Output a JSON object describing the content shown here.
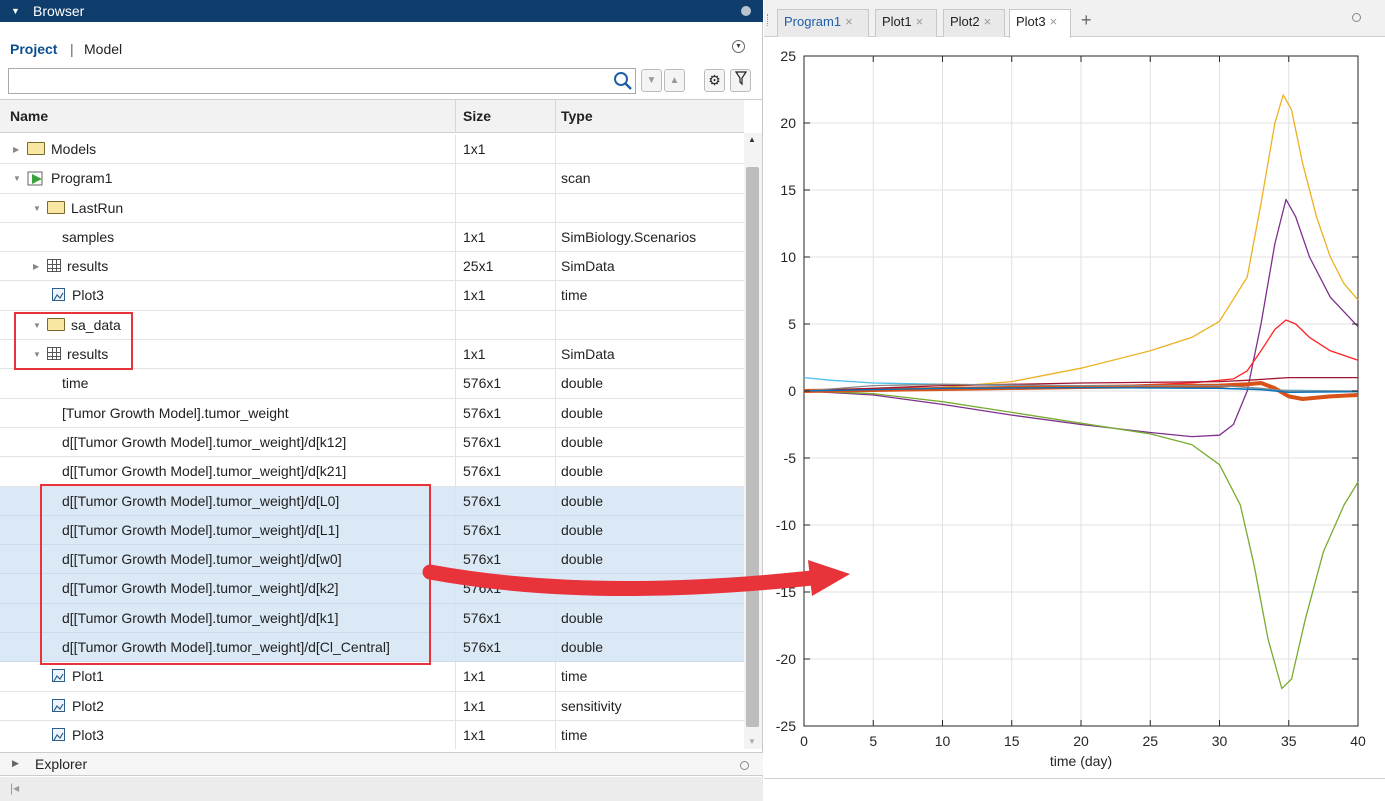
{
  "browser": {
    "title": "Browser"
  },
  "project_tabs": {
    "project": "Project",
    "separator": "|",
    "model": "Model"
  },
  "search": {
    "value": "",
    "placeholder": ""
  },
  "table": {
    "headers": {
      "name": "Name",
      "size": "Size",
      "type": "Type"
    },
    "rows": [
      {
        "name": "Models",
        "size": "1x1",
        "type": "",
        "icon": "folder-icon",
        "twisty": "collapsed"
      },
      {
        "name": "Program1",
        "size": "",
        "type": "scan",
        "icon": "program-icon",
        "twisty": "expanded"
      },
      {
        "name": "LastRun",
        "size": "",
        "type": "",
        "icon": "folder-icon",
        "twisty": "expanded"
      },
      {
        "name": "samples",
        "size": "1x1",
        "type": "SimBiology.Scenarios",
        "icon": "",
        "twisty": ""
      },
      {
        "name": "results",
        "size": "25x1",
        "type": "SimData",
        "icon": "table-icon",
        "twisty": "collapsed"
      },
      {
        "name": "Plot3",
        "size": "1x1",
        "type": "time",
        "icon": "plot-icon",
        "twisty": ""
      },
      {
        "name": "sa_data",
        "size": "",
        "type": "",
        "icon": "folder-icon",
        "twisty": "expanded"
      },
      {
        "name": "results",
        "size": "1x1",
        "type": "SimData",
        "icon": "table-icon",
        "twisty": "expanded"
      },
      {
        "name": "time",
        "size": "576x1",
        "type": "double",
        "icon": "",
        "twisty": ""
      },
      {
        "name": "[Tumor Growth Model].tumor_weight",
        "size": "576x1",
        "type": "double",
        "icon": "",
        "twisty": ""
      },
      {
        "name": "d[[Tumor Growth Model].tumor_weight]/d[k12]",
        "size": "576x1",
        "type": "double",
        "icon": "",
        "twisty": ""
      },
      {
        "name": "d[[Tumor Growth Model].tumor_weight]/d[k21]",
        "size": "576x1",
        "type": "double",
        "icon": "",
        "twisty": ""
      },
      {
        "name": "d[[Tumor Growth Model].tumor_weight]/d[L0]",
        "size": "576x1",
        "type": "double",
        "icon": "",
        "twisty": "",
        "selected": true
      },
      {
        "name": "d[[Tumor Growth Model].tumor_weight]/d[L1]",
        "size": "576x1",
        "type": "double",
        "icon": "",
        "twisty": "",
        "selected": true
      },
      {
        "name": "d[[Tumor Growth Model].tumor_weight]/d[w0]",
        "size": "576x1",
        "type": "double",
        "icon": "",
        "twisty": "",
        "selected": true
      },
      {
        "name": "d[[Tumor Growth Model].tumor_weight]/d[k2]",
        "size": "576x1",
        "type": "double",
        "icon": "",
        "twisty": "",
        "selected": true
      },
      {
        "name": "d[[Tumor Growth Model].tumor_weight]/d[k1]",
        "size": "576x1",
        "type": "double",
        "icon": "",
        "twisty": "",
        "selected": true
      },
      {
        "name": "d[[Tumor Growth Model].tumor_weight]/d[Cl_Central]",
        "size": "576x1",
        "type": "double",
        "icon": "",
        "twisty": "",
        "selected": true
      },
      {
        "name": "Plot1",
        "size": "1x1",
        "type": "time",
        "icon": "plot-icon",
        "twisty": ""
      },
      {
        "name": "Plot2",
        "size": "1x1",
        "type": "sensitivity",
        "icon": "plot-icon",
        "twisty": ""
      },
      {
        "name": "Plot3",
        "size": "1x1",
        "type": "time",
        "icon": "plot-icon",
        "twisty": ""
      }
    ]
  },
  "explorer": {
    "title": "Explorer"
  },
  "tabs": [
    {
      "label": "Program1",
      "close": "×"
    },
    {
      "label": "Plot1",
      "close": "×"
    },
    {
      "label": "Plot2",
      "close": "×"
    },
    {
      "label": "Plot3",
      "close": "×",
      "active": true
    }
  ],
  "tab_add": "+",
  "colors": {
    "header_bg": "#0f3e6c",
    "selection": "#dbe9f6",
    "highlight_red": "#e8333a",
    "series": [
      "#edb120",
      "#7e2f8e",
      "#ff2222",
      "#77ac30",
      "#4dbeee",
      "#d95319",
      "#a2142f",
      "#0072bd",
      "#888888"
    ]
  },
  "chart_data": {
    "type": "line",
    "xlabel": "time (day)",
    "ylabel": "",
    "xlim": [
      0,
      40
    ],
    "ylim": [
      -25,
      25
    ],
    "xticks": [
      0,
      5,
      10,
      15,
      20,
      25,
      30,
      35,
      40
    ],
    "yticks": [
      -25,
      -20,
      -15,
      -10,
      -5,
      0,
      5,
      10,
      15,
      20,
      25
    ],
    "grid": true,
    "series": [
      {
        "color": "#edb120",
        "points": [
          [
            0,
            0
          ],
          [
            8,
            0.1
          ],
          [
            15,
            0.7
          ],
          [
            20,
            1.7
          ],
          [
            25,
            3
          ],
          [
            28,
            4
          ],
          [
            30,
            5.2
          ],
          [
            32,
            8.5
          ],
          [
            33,
            14
          ],
          [
            34,
            20
          ],
          [
            34.6,
            22.1
          ],
          [
            35.2,
            21
          ],
          [
            36,
            17
          ],
          [
            37,
            13
          ],
          [
            38,
            10
          ],
          [
            39,
            8
          ],
          [
            40,
            6.8
          ]
        ]
      },
      {
        "color": "#7e2f8e",
        "points": [
          [
            0,
            0
          ],
          [
            5,
            -0.3
          ],
          [
            10,
            -1
          ],
          [
            15,
            -1.8
          ],
          [
            20,
            -2.5
          ],
          [
            25,
            -3.1
          ],
          [
            28,
            -3.4
          ],
          [
            30,
            -3.3
          ],
          [
            31,
            -2.5
          ],
          [
            32,
            0
          ],
          [
            33,
            5
          ],
          [
            34,
            11
          ],
          [
            34.8,
            14.3
          ],
          [
            35.5,
            13
          ],
          [
            36.5,
            10
          ],
          [
            38,
            7
          ],
          [
            40,
            4.8
          ]
        ]
      },
      {
        "color": "#ff2222",
        "points": [
          [
            0,
            0
          ],
          [
            10,
            0.1
          ],
          [
            20,
            0.3
          ],
          [
            28,
            0.6
          ],
          [
            31,
            0.9
          ],
          [
            32,
            1.5
          ],
          [
            33,
            3
          ],
          [
            34,
            4.6
          ],
          [
            34.8,
            5.3
          ],
          [
            35.5,
            5
          ],
          [
            36.5,
            4
          ],
          [
            38,
            3
          ],
          [
            40,
            2.3
          ]
        ]
      },
      {
        "color": "#77ac30",
        "points": [
          [
            0,
            0
          ],
          [
            5,
            -0.2
          ],
          [
            10,
            -0.8
          ],
          [
            15,
            -1.6
          ],
          [
            20,
            -2.4
          ],
          [
            25,
            -3.2
          ],
          [
            28,
            -4
          ],
          [
            30,
            -5.5
          ],
          [
            31.5,
            -8.5
          ],
          [
            32.5,
            -13
          ],
          [
            33.5,
            -18.5
          ],
          [
            34.5,
            -22.2
          ],
          [
            35.2,
            -21.5
          ],
          [
            36.2,
            -17
          ],
          [
            37.5,
            -12
          ],
          [
            39,
            -8.5
          ],
          [
            40,
            -6.8
          ]
        ]
      },
      {
        "color": "#4dbeee",
        "points": [
          [
            0,
            1
          ],
          [
            2,
            0.8
          ],
          [
            5,
            0.6
          ],
          [
            10,
            0.5
          ],
          [
            20,
            0.3
          ],
          [
            30,
            0.2
          ],
          [
            35,
            0.05
          ],
          [
            40,
            0
          ]
        ]
      },
      {
        "color": "#d95319",
        "points": [
          [
            0,
            0
          ],
          [
            10,
            0.15
          ],
          [
            20,
            0.3
          ],
          [
            30,
            0.4
          ],
          [
            32,
            0.5
          ],
          [
            33,
            0.6
          ],
          [
            34,
            0.2
          ],
          [
            35,
            -0.4
          ],
          [
            36,
            -0.6
          ],
          [
            38,
            -0.4
          ],
          [
            40,
            -0.3
          ]
        ]
      },
      {
        "color": "#a2142f",
        "points": [
          [
            0,
            0
          ],
          [
            10,
            0.4
          ],
          [
            20,
            0.6
          ],
          [
            30,
            0.7
          ],
          [
            32,
            0.8
          ],
          [
            35,
            1
          ],
          [
            40,
            1
          ]
        ]
      },
      {
        "color": "#888888",
        "points": [
          [
            0,
            0
          ],
          [
            5,
            0.4
          ],
          [
            10,
            0.5
          ],
          [
            20,
            0.4
          ],
          [
            30,
            0.4
          ],
          [
            33,
            0.2
          ],
          [
            35,
            0
          ],
          [
            40,
            0
          ]
        ]
      },
      {
        "color": "#0072bd",
        "points": [
          [
            0,
            0
          ],
          [
            10,
            0.2
          ],
          [
            20,
            0.25
          ],
          [
            30,
            0.2
          ],
          [
            33,
            0.1
          ],
          [
            35,
            -0.1
          ],
          [
            40,
            -0.05
          ]
        ]
      }
    ]
  }
}
